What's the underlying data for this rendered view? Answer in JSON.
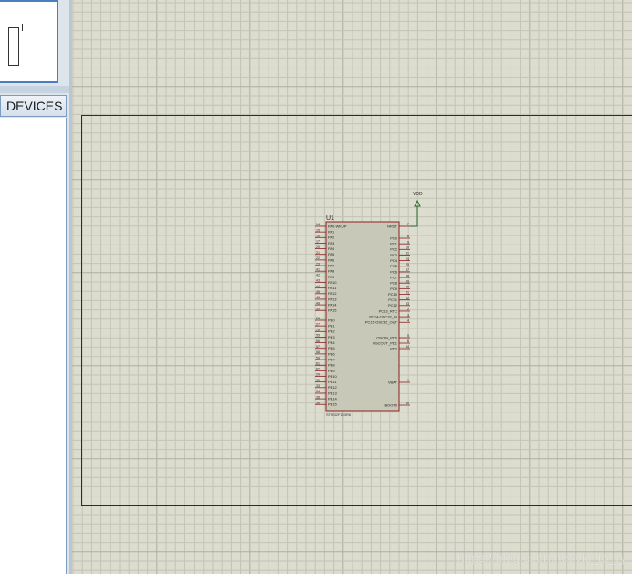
{
  "devices_panel": {
    "header": "DEVICES"
  },
  "component": {
    "ref": "U1",
    "part": "STM32F103R6",
    "power_label": "VDD",
    "left_pins": [
      {
        "num": "14",
        "name": "PA0-WKUP"
      },
      {
        "num": "15",
        "name": "PA1"
      },
      {
        "num": "16",
        "name": "PA2"
      },
      {
        "num": "17",
        "name": "PA3"
      },
      {
        "num": "20",
        "name": "PA4"
      },
      {
        "num": "21",
        "name": "PA5"
      },
      {
        "num": "22",
        "name": "PA6"
      },
      {
        "num": "23",
        "name": "PA7"
      },
      {
        "num": "41",
        "name": "PA8"
      },
      {
        "num": "42",
        "name": "PA9"
      },
      {
        "num": "43",
        "name": "PA10"
      },
      {
        "num": "44",
        "name": "PA11"
      },
      {
        "num": "45",
        "name": "PA12"
      },
      {
        "num": "46",
        "name": "PA13"
      },
      {
        "num": "49",
        "name": "PA14"
      },
      {
        "num": "50",
        "name": "PA15"
      },
      {
        "num": "26",
        "name": "PB0"
      },
      {
        "num": "27",
        "name": "PB1"
      },
      {
        "num": "28",
        "name": "PB2"
      },
      {
        "num": "55",
        "name": "PB3"
      },
      {
        "num": "56",
        "name": "PB4"
      },
      {
        "num": "57",
        "name": "PB5"
      },
      {
        "num": "58",
        "name": "PB6"
      },
      {
        "num": "59",
        "name": "PB7"
      },
      {
        "num": "61",
        "name": "PB8"
      },
      {
        "num": "62",
        "name": "PB9"
      },
      {
        "num": "29",
        "name": "PB10"
      },
      {
        "num": "30",
        "name": "PB11"
      },
      {
        "num": "33",
        "name": "PB12"
      },
      {
        "num": "34",
        "name": "PB13"
      },
      {
        "num": "35",
        "name": "PB14"
      },
      {
        "num": "36",
        "name": "PB15"
      }
    ],
    "right_pins": [
      {
        "num": "7",
        "name": "NRST"
      },
      {
        "num": "8",
        "name": "PC0"
      },
      {
        "num": "9",
        "name": "PC1"
      },
      {
        "num": "10",
        "name": "PC2"
      },
      {
        "num": "11",
        "name": "PC3"
      },
      {
        "num": "24",
        "name": "PC4"
      },
      {
        "num": "25",
        "name": "PC5"
      },
      {
        "num": "37",
        "name": "PC6"
      },
      {
        "num": "38",
        "name": "PC7"
      },
      {
        "num": "39",
        "name": "PC8"
      },
      {
        "num": "40",
        "name": "PC9"
      },
      {
        "num": "51",
        "name": "PC10"
      },
      {
        "num": "52",
        "name": "PC11"
      },
      {
        "num": "53",
        "name": "PC12"
      },
      {
        "num": "2",
        "name": "PC13_RTC"
      },
      {
        "num": "3",
        "name": "PC14-OSC32_IN"
      },
      {
        "num": "4",
        "name": "PC15-OSC32_OUT"
      },
      {
        "num": "5",
        "name": "OSCIN_PD0"
      },
      {
        "num": "6",
        "name": "OSCOUT_PD1"
      },
      {
        "num": "54",
        "name": "PD2"
      },
      {
        "num": "1",
        "name": "VBAT"
      },
      {
        "num": "60",
        "name": "BOOT0"
      }
    ]
  },
  "watermark": "https://blog.csdn.net/vic_to_ry",
  "colors": {
    "grid": "#c4c4b6",
    "grid_major": "#aeaea0",
    "sheet_border": "#1b1bb4",
    "chip_fill": "#c8c8b8",
    "chip_outline": "#8c2020",
    "pin": "#8c2020",
    "power": "#2a6a2a"
  }
}
